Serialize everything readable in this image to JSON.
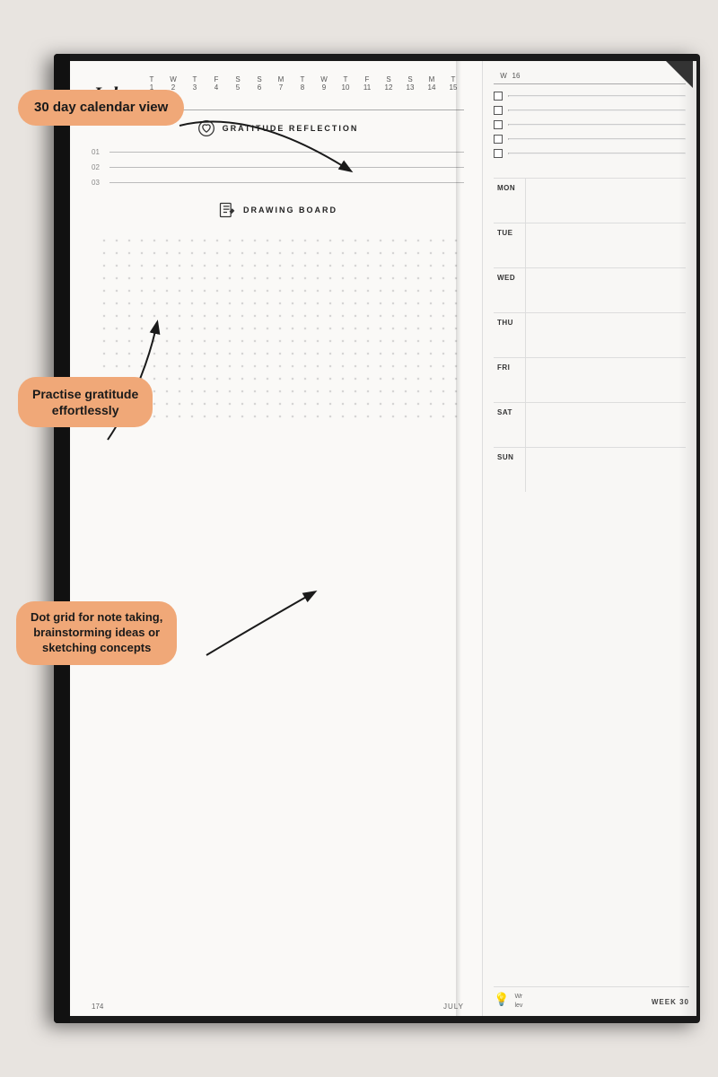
{
  "book": {
    "left_page": {
      "month": "July",
      "calendar": {
        "day_letters": [
          "T",
          "W",
          "T",
          "F",
          "S",
          "S",
          "M",
          "T",
          "W",
          "T",
          "F",
          "S",
          "S",
          "M",
          "T"
        ],
        "day_numbers": [
          "1",
          "2",
          "3",
          "4",
          "5",
          "6",
          "7",
          "8",
          "9",
          "10",
          "11",
          "12",
          "13",
          "14",
          "15"
        ]
      },
      "gratitude": {
        "title": "GRATITUDE REFLECTION",
        "lines": [
          "01",
          "02",
          "03"
        ]
      },
      "drawing_board": {
        "title": "DRAWING BOARD"
      },
      "footer": {
        "page_num": "174",
        "month": "JULY"
      }
    },
    "right_page": {
      "checklist_count": 5,
      "days": [
        {
          "label": "MON"
        },
        {
          "label": "TUE"
        },
        {
          "label": "WED"
        },
        {
          "label": "THU"
        },
        {
          "label": "FRI"
        },
        {
          "label": "SAT"
        },
        {
          "label": "SUN"
        }
      ],
      "footer": {
        "week_text": "Wr lev",
        "week_label": "WEEK 30",
        "right_calendar_letter": "W",
        "right_calendar_num": "16"
      }
    }
  },
  "callouts": {
    "c1": "30 day calendar view",
    "c2_line1": "Practise gratitude",
    "c2_line2": "effortlessly",
    "c3_line1": "Dot grid for note taking,",
    "c3_line2": "brainstorming ideas or",
    "c3_line3": "sketching concepts"
  }
}
